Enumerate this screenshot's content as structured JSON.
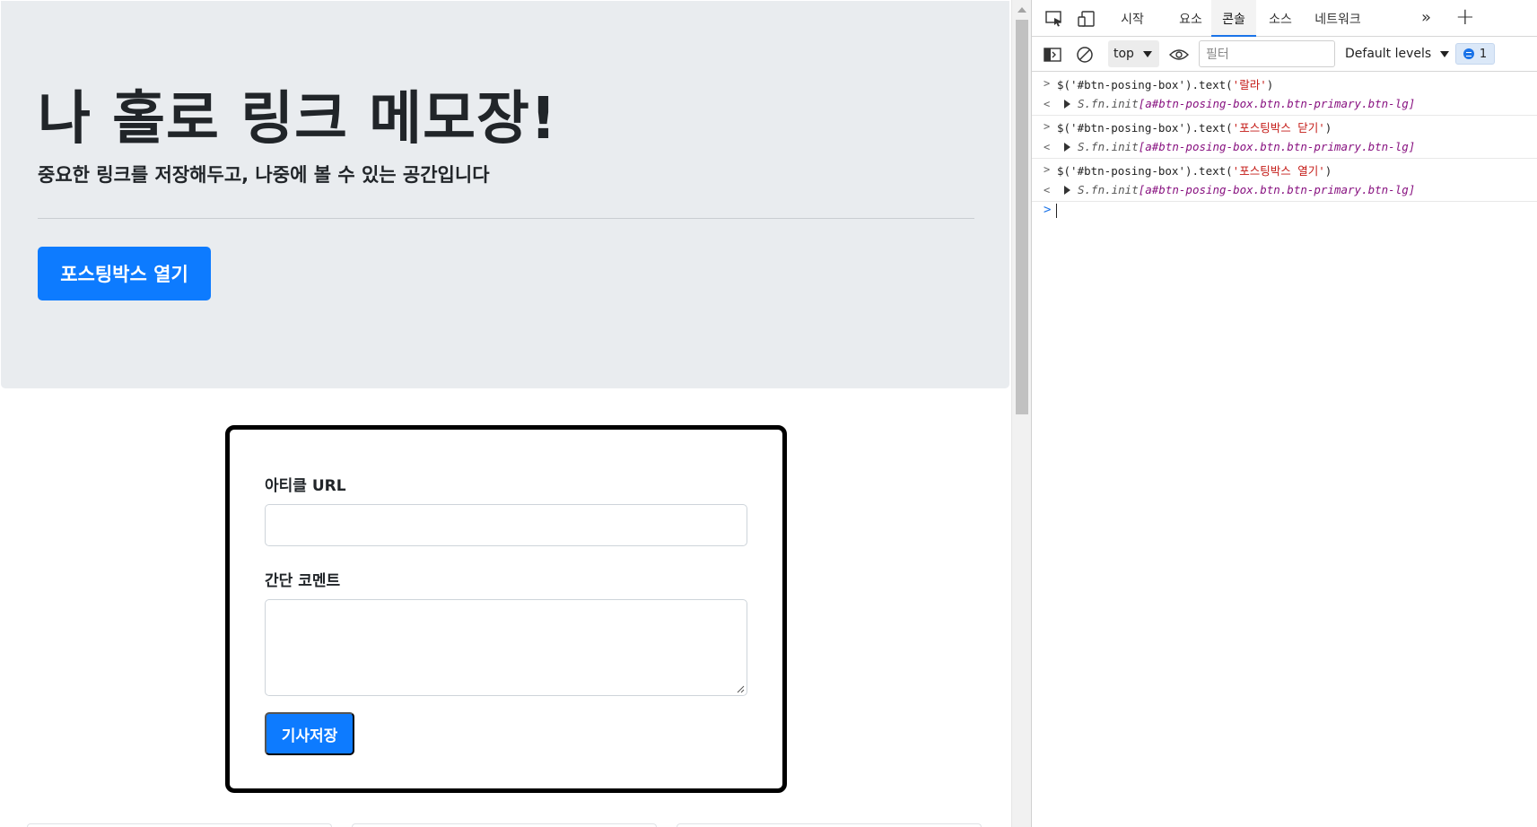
{
  "page": {
    "title": "나 홀로 링크 메모장!",
    "lead": "중요한 링크를 저장해두고, 나중에 볼 수 있는 공간입니다",
    "open_button": "포스팅박스 열기",
    "form": {
      "url_label": "아티클 URL",
      "url_value": "",
      "comment_label": "간단 코멘트",
      "comment_value": "",
      "save_button": "기사저장"
    }
  },
  "devtools": {
    "tabs": [
      "시작",
      "요소",
      "콘솔",
      "소스",
      "네트워크"
    ],
    "active_tab": "콘솔",
    "context": "top",
    "filter_placeholder": "필터",
    "levels": "Default levels",
    "issues_count": "1",
    "console": [
      {
        "input_prefix": "$('#btn-posing-box').text(",
        "input_arg": "'랄라'",
        "input_suffix": ")",
        "result_type": "S.fn.init ",
        "result_node": "[a#btn-posing-box.btn.btn-primary.btn-lg]"
      },
      {
        "input_prefix": "$('#btn-posing-box').text(",
        "input_arg": "'포스팅박스 닫기'",
        "input_suffix": ")",
        "result_type": "S.fn.init ",
        "result_node": "[a#btn-posing-box.btn.btn-primary.btn-lg]"
      },
      {
        "input_prefix": "$('#btn-posing-box').text(",
        "input_arg": "'포스팅박스 열기'",
        "input_suffix": ")",
        "result_type": "S.fn.init ",
        "result_node": "[a#btn-posing-box.btn.btn-primary.btn-lg]"
      }
    ]
  },
  "colors": {
    "primary": "#0d7bff",
    "jumbotron_bg": "#e9ecef",
    "devtools_accent": "#1a73e8"
  },
  "icons": {
    "inspect": "inspect-element-icon",
    "device": "device-toolbar-icon",
    "sidebar": "console-sidebar-icon",
    "clear": "clear-console-icon",
    "eye": "live-expression-icon",
    "more_tabs": "more-tabs-icon",
    "add_tab": "add-tab-icon"
  }
}
